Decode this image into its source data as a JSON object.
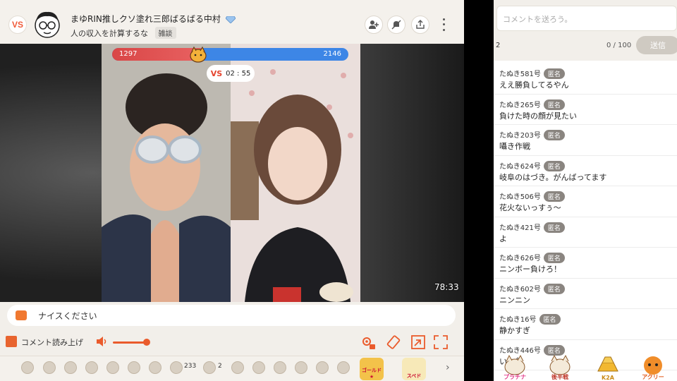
{
  "header": {
    "logo": "VS",
    "title": "まゆRIN推しクソ塗れ三郎ばるばる中村",
    "subtitle": "人の収入を計算するな",
    "category_tag": "雑談"
  },
  "battle": {
    "left_score": "1297",
    "right_score": "2146",
    "left_share": 0.377,
    "timer_prefix": "VS",
    "timer": "02 : 55"
  },
  "video": {
    "duration": "78:33"
  },
  "comment_box": {
    "placeholder": "ナイスください"
  },
  "controls": {
    "read_aloud_label": "コメント読み上げ",
    "volume_level": 0.9
  },
  "gifts": {
    "count_a": "233",
    "count_b": "2",
    "badge_a": "ゴールド★",
    "badge_b": "スペド"
  },
  "sidebar": {
    "comment_placeholder": "コメントを送ろう。",
    "char_count": "0 / 100",
    "send_label": "送信",
    "left_number": "2",
    "anon_label": "匿名",
    "comments": [
      {
        "name": "たぬき581号",
        "text": "ええ勝負してるやん"
      },
      {
        "name": "たぬき265号",
        "text": "負けた時の顔が見たい"
      },
      {
        "name": "たぬき203号",
        "text": "囁き作戦"
      },
      {
        "name": "たぬき624号",
        "text": "岐阜のはづき。がんばってます"
      },
      {
        "name": "たぬき506号",
        "text": "花火ないっすぅ～"
      },
      {
        "name": "たぬき421号",
        "text": "よ"
      },
      {
        "name": "たぬき626号",
        "text": "ニンボー負けろ！"
      },
      {
        "name": "たぬき602号",
        "text": "ニンニン"
      },
      {
        "name": "たぬき16号",
        "text": "静かすぎ"
      },
      {
        "name": "たぬき446号",
        "text": "いい負"
      }
    ],
    "badges": [
      "プラチナ",
      "後半戦",
      "K2A",
      "アクリー"
    ]
  },
  "colors": {
    "accent": "#ea5b2c",
    "red_team": "#d94646",
    "blue_team": "#3d86e6"
  }
}
